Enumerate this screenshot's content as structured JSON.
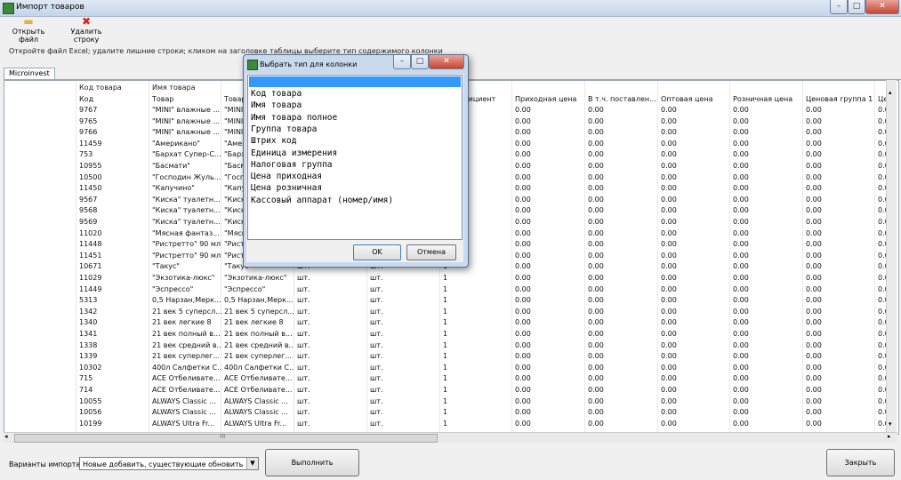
{
  "window": {
    "title": "Импорт товаров"
  },
  "toolbar": {
    "open_label": "Открыть файл",
    "delete_label": "Удалить строку"
  },
  "info": "Откройте файл Excel;  удалите лишние строки;  кликом на заголовке таблицы выберите тип содержимого колонки",
  "tab": "Microinvest",
  "grid": {
    "assigned": [
      "Код товара",
      "Имя товара"
    ],
    "headers": [
      "Код",
      "Товар",
      "Товар",
      "",
      "",
      "Коэффициент",
      "Приходная цена",
      "В т.ч. поставлен...",
      "Оптовая цена",
      "Розничная цена",
      "Ценовая группа 1",
      "Цен"
    ],
    "rows": [
      [
        "9767",
        "\"MINI\" влажные ...",
        "\"MINI\" влажные ...",
        "шт.",
        "шт.",
        "1",
        "0.00",
        "0.00",
        "0.00",
        "0.00",
        "0.00",
        "0.00"
      ],
      [
        "9765",
        "\"MINI\" влажные ...",
        "\"MINI\" влажные ...",
        "шт.",
        "шт.",
        "1",
        "0.00",
        "0.00",
        "0.00",
        "0.00",
        "0.00",
        "0.00"
      ],
      [
        "9766",
        "\"MINI\" влажные ...",
        "\"MINI\" влажные ...",
        "шт.",
        "шт.",
        "1",
        "0.00",
        "0.00",
        "0.00",
        "0.00",
        "0.00",
        "0.00"
      ],
      [
        "11459",
        "\"Американо\"",
        "\"Американо\"",
        "шт.",
        "шт.",
        "1",
        "0.00",
        "0.00",
        "0.00",
        "0.00",
        "0.00",
        "0.00"
      ],
      [
        "753",
        "\"Бархат Супер-С...",
        "\"Бархат Супер-С...",
        "шт.",
        "шт.",
        "1",
        "0.00",
        "0.00",
        "0.00",
        "0.00",
        "0.00",
        "0.00"
      ],
      [
        "10955",
        "\"Басмати\"",
        "\"Басмати\"",
        "шт.",
        "шт.",
        "1",
        "0.00",
        "0.00",
        "0.00",
        "0.00",
        "0.00",
        "0.00"
      ],
      [
        "10500",
        "\"Господин Жуль...",
        "\"Господин Жуль...",
        "шт.",
        "шт.",
        "1",
        "0.00",
        "0.00",
        "0.00",
        "0.00",
        "0.00",
        "0.00"
      ],
      [
        "11450",
        "\"Капучино\"",
        "\"Капучино\"",
        "шт.",
        "шт.",
        "1",
        "0.00",
        "0.00",
        "0.00",
        "0.00",
        "0.00",
        "0.00"
      ],
      [
        "9567",
        "\"Киска\" туалетн...",
        "\"Киска\" туалетн...",
        "шт.",
        "шт.",
        "1",
        "0.00",
        "0.00",
        "0.00",
        "0.00",
        "0.00",
        "0.00"
      ],
      [
        "9568",
        "\"Киска\" туалетн...",
        "\"Киска\" туалетн...",
        "шт.",
        "шт.",
        "1",
        "0.00",
        "0.00",
        "0.00",
        "0.00",
        "0.00",
        "0.00"
      ],
      [
        "9569",
        "\"Киска\" туалетн...",
        "\"Киска\" туалетн...",
        "шт.",
        "шт.",
        "1",
        "0.00",
        "0.00",
        "0.00",
        "0.00",
        "0.00",
        "0.00"
      ],
      [
        "11020",
        "\"Мясная фантаз...",
        "\"Мясная фантаз...",
        "шт.",
        "шт.",
        "1",
        "0.00",
        "0.00",
        "0.00",
        "0.00",
        "0.00",
        "0.00"
      ],
      [
        "11448",
        "\"Ристретто\" 90 мл",
        "\"Ристретто\" 90 мл",
        "шт.",
        "шт.",
        "1",
        "0.00",
        "0.00",
        "0.00",
        "0.00",
        "0.00",
        "0.00"
      ],
      [
        "11451",
        "\"Ристретто\" 90 мл",
        "\"Ристретто\" 90 мл",
        "шт.",
        "шт.",
        "1",
        "0.00",
        "0.00",
        "0.00",
        "0.00",
        "0.00",
        "0.00"
      ],
      [
        "10671",
        "\"Такус\"",
        "\"Такус\"",
        "шт.",
        "шт.",
        "1",
        "0.00",
        "0.00",
        "0.00",
        "0.00",
        "0.00",
        "0.00"
      ],
      [
        "11029",
        "\"Экзотика-люкс\"",
        "\"Экзотика-люкс\"",
        "шт.",
        "шт.",
        "1",
        "0.00",
        "0.00",
        "0.00",
        "0.00",
        "0.00",
        "0.00"
      ],
      [
        "11449",
        "\"Эспрессо\"",
        "\"Эспрессо\"",
        "шт.",
        "шт.",
        "1",
        "0.00",
        "0.00",
        "0.00",
        "0.00",
        "0.00",
        "0.00"
      ],
      [
        "5313",
        "0,5 Нарзан,Мерк...",
        "0,5 Нарзан,Мерк...",
        "шт.",
        "шт.",
        "1",
        "0.00",
        "0.00",
        "0.00",
        "0.00",
        "0.00",
        "0.00"
      ],
      [
        "1342",
        "21 век 5 суперсл...",
        "21 век 5 суперсл...",
        "шт.",
        "шт.",
        "1",
        "0.00",
        "0.00",
        "0.00",
        "0.00",
        "0.00",
        "0.00"
      ],
      [
        "1340",
        "21 век легкие 8",
        "21 век легкие 8",
        "шт.",
        "шт.",
        "1",
        "0.00",
        "0.00",
        "0.00",
        "0.00",
        "0.00",
        "0.00"
      ],
      [
        "1341",
        "21 век полный в...",
        "21 век полный в...",
        "шт.",
        "шт.",
        "1",
        "0.00",
        "0.00",
        "0.00",
        "0.00",
        "0.00",
        "0.00"
      ],
      [
        "1338",
        "21 век средний в...",
        "21 век средний в...",
        "шт.",
        "шт.",
        "1",
        "0.00",
        "0.00",
        "0.00",
        "0.00",
        "0.00",
        "0.00"
      ],
      [
        "1339",
        "21 век суперлег...",
        "21 век суперлег...",
        "шт.",
        "шт.",
        "1",
        "0.00",
        "0.00",
        "0.00",
        "0.00",
        "0.00",
        "0.00"
      ],
      [
        "10302",
        "400л Салфетки С...",
        "400л Салфетки С...",
        "шт.",
        "шт.",
        "1",
        "0.00",
        "0.00",
        "0.00",
        "0.00",
        "0.00",
        "0.00"
      ],
      [
        "715",
        "ACE Отбеливате...",
        "ACE Отбеливате...",
        "шт.",
        "шт.",
        "1",
        "0.00",
        "0.00",
        "0.00",
        "0.00",
        "0.00",
        "0.00"
      ],
      [
        "714",
        "ACE Отбеливате...",
        "ACE Отбеливате...",
        "шт.",
        "шт.",
        "1",
        "0.00",
        "0.00",
        "0.00",
        "0.00",
        "0.00",
        "0.00"
      ],
      [
        "10055",
        "ALWAYS Classic ...",
        "ALWAYS Classic ...",
        "шт.",
        "шт.",
        "1",
        "0.00",
        "0.00",
        "0.00",
        "0.00",
        "0.00",
        "0.00"
      ],
      [
        "10056",
        "ALWAYS Classic ...",
        "ALWAYS Classic ...",
        "шт.",
        "шт.",
        "1",
        "0.00",
        "0.00",
        "0.00",
        "0.00",
        "0.00",
        "0.00"
      ],
      [
        "10199",
        "ALWAYS Ultra Fr...",
        "ALWAYS Ultra Fr...",
        "шт.",
        "шт.",
        "1",
        "0.00",
        "0.00",
        "0.00",
        "0.00",
        "0.00",
        "0.00"
      ]
    ]
  },
  "scroll": {
    "thumb_glyph": "III"
  },
  "bottom": {
    "import_label": "Варианты импорта:",
    "import_value": "Новые добавить, существующие обновить",
    "run_label": "Выполнить",
    "close_label": "Закрыть"
  },
  "dialog": {
    "title": "Выбрать тип для колонки",
    "options": [
      "Код товара",
      "Имя товара",
      "Имя товара полное",
      "Группа товара",
      "Штрих код",
      "Единица измерения",
      "Налоговая группа",
      "Цена приходная",
      "Цена розничная",
      "Кассовый аппарат (номер/имя)"
    ],
    "ok_label": "OK",
    "cancel_label": "Отмена"
  }
}
